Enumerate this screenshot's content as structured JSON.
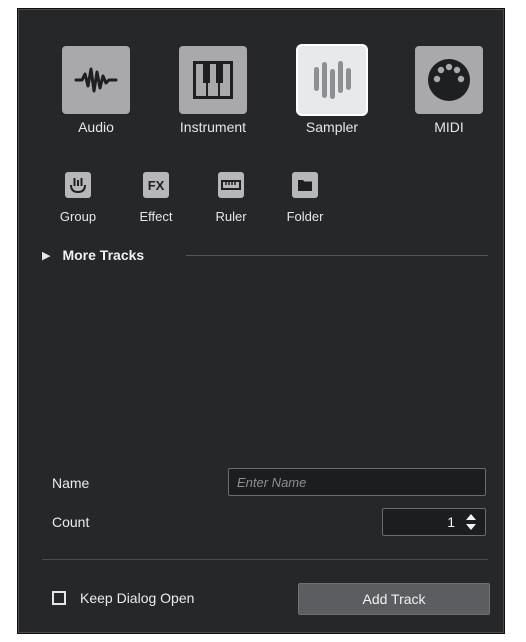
{
  "track_types": {
    "primary": [
      {
        "label": "Audio",
        "icon": "audio-waveform-icon",
        "selected": false
      },
      {
        "label": "Instrument",
        "icon": "piano-keys-icon",
        "selected": false
      },
      {
        "label": "Sampler",
        "icon": "sampler-bars-icon",
        "selected": true
      },
      {
        "label": "MIDI",
        "icon": "midi-connector-icon",
        "selected": false
      }
    ],
    "secondary": [
      {
        "label": "Group",
        "icon": "group-icon"
      },
      {
        "label": "Effect",
        "icon": "fx-icon",
        "icon_text": "FX"
      },
      {
        "label": "Ruler",
        "icon": "ruler-icon"
      },
      {
        "label": "Folder",
        "icon": "folder-icon"
      }
    ]
  },
  "more_tracks": {
    "label": "More Tracks",
    "expanded": false
  },
  "name_field": {
    "label": "Name",
    "placeholder": "Enter Name",
    "value": ""
  },
  "count_field": {
    "label": "Count",
    "value": "1"
  },
  "keep_dialog_open": {
    "label": "Keep Dialog Open",
    "checked": false
  },
  "add_track_button": {
    "label": "Add Track"
  },
  "colors": {
    "dialog_bg": "#262729",
    "tile_normal": "#a9a9ab",
    "tile_selected": "#e8e9eb",
    "text": "#e6e6e6",
    "button_bg": "#5c5d61"
  }
}
